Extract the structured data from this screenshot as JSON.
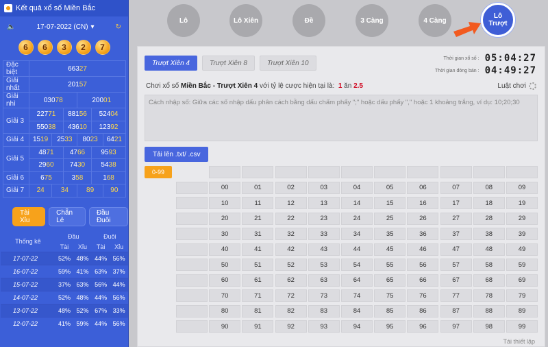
{
  "left": {
    "title": "Kết quả xổ số Miền Bắc",
    "date": "17-07-2022 (CN)",
    "balls": [
      "6",
      "6",
      "3",
      "2",
      "7"
    ],
    "results": [
      {
        "label": "Đặc biệt",
        "values": [
          {
            "a": "663",
            "b": "27"
          }
        ]
      },
      {
        "label": "Giải nhất",
        "values": [
          {
            "a": "201",
            "b": "57"
          }
        ]
      },
      {
        "label": "Giải nhì",
        "values": [
          {
            "a": "030",
            "b": "78"
          },
          {
            "a": "200",
            "b": "01"
          }
        ]
      },
      {
        "label": "Giải 3",
        "values": [
          {
            "a": "227",
            "b": "71"
          },
          {
            "a": "881",
            "b": "56"
          },
          {
            "a": "524",
            "b": "04"
          },
          {
            "a": "550",
            "b": "38"
          },
          {
            "a": "436",
            "b": "10"
          },
          {
            "a": "123",
            "b": "92"
          }
        ]
      },
      {
        "label": "Giải 4",
        "values": [
          {
            "a": "15",
            "b": "19"
          },
          {
            "a": "25",
            "b": "33"
          },
          {
            "a": "80",
            "b": "23"
          },
          {
            "a": "64",
            "b": "21"
          }
        ]
      },
      {
        "label": "Giải 5",
        "values": [
          {
            "a": "48",
            "b": "71"
          },
          {
            "a": "47",
            "b": "66"
          },
          {
            "a": "95",
            "b": "93"
          },
          {
            "a": "29",
            "b": "60"
          },
          {
            "a": "74",
            "b": "30"
          },
          {
            "a": "54",
            "b": "38"
          }
        ]
      },
      {
        "label": "Giải 6",
        "values": [
          {
            "a": "6",
            "b": "75"
          },
          {
            "a": "3",
            "b": "58"
          },
          {
            "a": "1",
            "b": "68"
          }
        ]
      },
      {
        "label": "Giải 7",
        "values": [
          {
            "a": "",
            "b": "24"
          },
          {
            "a": "",
            "b": "34"
          },
          {
            "a": "",
            "b": "89"
          },
          {
            "a": "",
            "b": "90"
          }
        ]
      }
    ],
    "pills": [
      "Tài Xỉu",
      "Chẵn Lẻ",
      "Đầu Đuôi"
    ],
    "stats": {
      "title": "Thống kê",
      "group1": "Đầu",
      "group2": "Đuôi",
      "col1": "Tài",
      "col2": "Xỉu",
      "col3": "Tài",
      "col4": "Xỉu",
      "rows": [
        [
          "17-07-22",
          "52%",
          "48%",
          "44%",
          "56%"
        ],
        [
          "16-07-22",
          "59%",
          "41%",
          "63%",
          "37%"
        ],
        [
          "15-07-22",
          "37%",
          "63%",
          "56%",
          "44%"
        ],
        [
          "14-07-22",
          "52%",
          "48%",
          "44%",
          "56%"
        ],
        [
          "13-07-22",
          "48%",
          "52%",
          "67%",
          "33%"
        ],
        [
          "12-07-22",
          "41%",
          "59%",
          "44%",
          "56%"
        ]
      ]
    }
  },
  "game_tabs": [
    "Lô",
    "Lô Xiên",
    "Đề",
    "3 Càng",
    "4 Càng",
    "Lô Trượt"
  ],
  "play_tabs": [
    "Trượt Xiên 4",
    "Trượt Xiên 8",
    "Trượt Xiên 10"
  ],
  "timers": [
    {
      "label": "Thời gian xổ số :",
      "value": "05:04:27"
    },
    {
      "label": "Thời gian đóng bán :",
      "value": "04:49:27"
    }
  ],
  "rate": {
    "prefix": "Chơi xổ số",
    "region": "Miền Bắc - Trượt Xiên 4",
    "middle": "với tỷ lệ cược hiện tại là:",
    "v1": "1",
    "sep": "ăn",
    "v2": "2.5"
  },
  "help": "Luật chơi",
  "textarea_placeholder": "Cách nhập số: Giữa các số nhập dấu phân cách bằng dấu chấm phẩy \";\" hoặc dấu phẩy \",\" hoặc 1 khoảng trắng, ví dụ: 10;20;30",
  "upload_label": "Tải lên .txt/ .csv",
  "range_label": "0-99",
  "reset_label": "Tái thiết lập"
}
